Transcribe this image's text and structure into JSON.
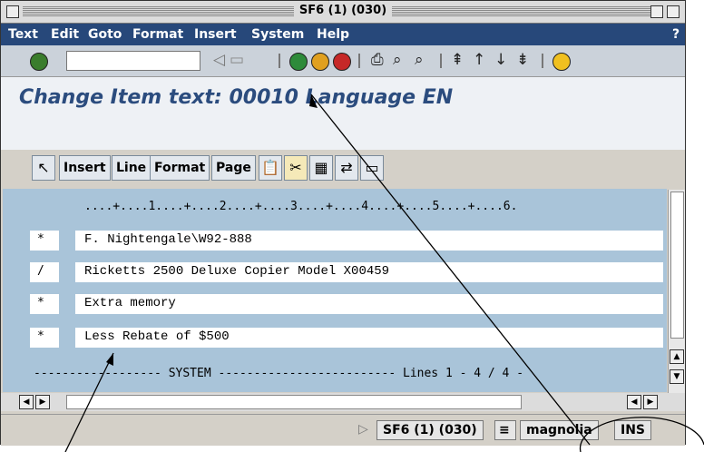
{
  "window": {
    "title": "SF6 (1) (030)"
  },
  "menu": [
    "Text",
    "Edit",
    "Goto",
    "Format",
    "Insert",
    "System",
    "Help"
  ],
  "menu_help_icon": "?",
  "toolbar": {
    "command_value": ""
  },
  "page": {
    "title": "Change Item text: 00010 Language EN"
  },
  "app_toolbar": {
    "buttons": [
      "Insert",
      "Line",
      "Format",
      "Page"
    ]
  },
  "editor": {
    "ruler": "....+....1....+....2....+....3....+....4....+....5....+....6.",
    "lines": [
      {
        "format": "*",
        "text": "F. Nightengale\\W92-888"
      },
      {
        "format": "/",
        "text": "Ricketts 2500 Deluxe Copier Model X00459"
      },
      {
        "format": "*",
        "text": "Extra memory"
      },
      {
        "format": "*",
        "text": "Less Rebate of $500"
      }
    ],
    "status_line": "------------------ SYSTEM ------------------------- Lines 1 - 4 / 4 -"
  },
  "statusbar": {
    "system": "SF6 (1) (030)",
    "server": "magnolia",
    "mode": "INS"
  },
  "colors": {
    "menubar": "#27487a",
    "title_text": "#2b4c7e",
    "editor_bg": "#a9c4d9"
  }
}
